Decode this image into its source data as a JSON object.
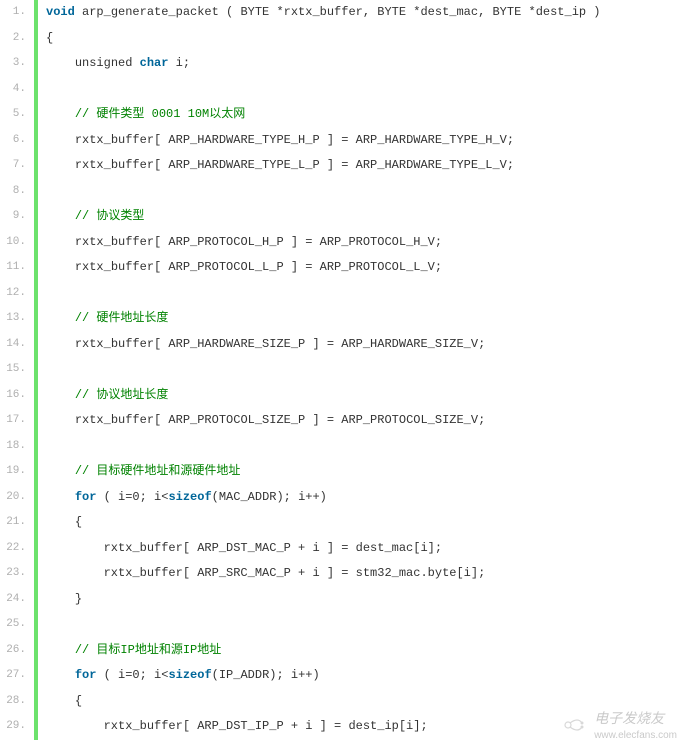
{
  "lines": [
    {
      "num": "1.",
      "indent": 0,
      "tokens": [
        {
          "t": "kw",
          "v": "void"
        },
        {
          "t": "",
          "v": " arp_generate_packet ( BYTE *rxtx_buffer, BYTE *dest_mac, BYTE *dest_ip )"
        }
      ]
    },
    {
      "num": "2.",
      "indent": 0,
      "tokens": [
        {
          "t": "",
          "v": "{"
        }
      ]
    },
    {
      "num": "3.",
      "indent": 1,
      "tokens": [
        {
          "t": "",
          "v": "unsigned "
        },
        {
          "t": "kw",
          "v": "char"
        },
        {
          "t": "",
          "v": " i;"
        }
      ]
    },
    {
      "num": "4.",
      "indent": 0,
      "tokens": []
    },
    {
      "num": "5.",
      "indent": 1,
      "tokens": [
        {
          "t": "comment",
          "v": "// 硬件类型 0001 10M以太网"
        }
      ]
    },
    {
      "num": "6.",
      "indent": 1,
      "tokens": [
        {
          "t": "",
          "v": "rxtx_buffer[ ARP_HARDWARE_TYPE_H_P ] = ARP_HARDWARE_TYPE_H_V;"
        }
      ]
    },
    {
      "num": "7.",
      "indent": 1,
      "tokens": [
        {
          "t": "",
          "v": "rxtx_buffer[ ARP_HARDWARE_TYPE_L_P ] = ARP_HARDWARE_TYPE_L_V;"
        }
      ]
    },
    {
      "num": "8.",
      "indent": 0,
      "tokens": []
    },
    {
      "num": "9.",
      "indent": 1,
      "tokens": [
        {
          "t": "comment",
          "v": "// 协议类型"
        }
      ]
    },
    {
      "num": "10.",
      "indent": 1,
      "tokens": [
        {
          "t": "",
          "v": "rxtx_buffer[ ARP_PROTOCOL_H_P ] = ARP_PROTOCOL_H_V;"
        }
      ]
    },
    {
      "num": "11.",
      "indent": 1,
      "tokens": [
        {
          "t": "",
          "v": "rxtx_buffer[ ARP_PROTOCOL_L_P ] = ARP_PROTOCOL_L_V;"
        }
      ]
    },
    {
      "num": "12.",
      "indent": 0,
      "tokens": []
    },
    {
      "num": "13.",
      "indent": 1,
      "tokens": [
        {
          "t": "comment",
          "v": "// 硬件地址长度"
        }
      ]
    },
    {
      "num": "14.",
      "indent": 1,
      "tokens": [
        {
          "t": "",
          "v": "rxtx_buffer[ ARP_HARDWARE_SIZE_P ] = ARP_HARDWARE_SIZE_V;"
        }
      ]
    },
    {
      "num": "15.",
      "indent": 0,
      "tokens": []
    },
    {
      "num": "16.",
      "indent": 1,
      "tokens": [
        {
          "t": "comment",
          "v": "// 协议地址长度"
        }
      ]
    },
    {
      "num": "17.",
      "indent": 1,
      "tokens": [
        {
          "t": "",
          "v": "rxtx_buffer[ ARP_PROTOCOL_SIZE_P ] = ARP_PROTOCOL_SIZE_V;"
        }
      ]
    },
    {
      "num": "18.",
      "indent": 0,
      "tokens": []
    },
    {
      "num": "19.",
      "indent": 1,
      "tokens": [
        {
          "t": "comment",
          "v": "// 目标硬件地址和源硬件地址"
        }
      ]
    },
    {
      "num": "20.",
      "indent": 1,
      "tokens": [
        {
          "t": "kw",
          "v": "for"
        },
        {
          "t": "",
          "v": " ( i=0; i<"
        },
        {
          "t": "kw",
          "v": "sizeof"
        },
        {
          "t": "",
          "v": "(MAC_ADDR); i++)"
        }
      ]
    },
    {
      "num": "21.",
      "indent": 1,
      "tokens": [
        {
          "t": "",
          "v": "{"
        }
      ]
    },
    {
      "num": "22.",
      "indent": 2,
      "tokens": [
        {
          "t": "",
          "v": "rxtx_buffer[ ARP_DST_MAC_P + i ] = dest_mac[i];"
        }
      ]
    },
    {
      "num": "23.",
      "indent": 2,
      "tokens": [
        {
          "t": "",
          "v": "rxtx_buffer[ ARP_SRC_MAC_P + i ] = stm32_mac.byte[i];"
        }
      ]
    },
    {
      "num": "24.",
      "indent": 1,
      "tokens": [
        {
          "t": "",
          "v": "}"
        }
      ]
    },
    {
      "num": "25.",
      "indent": 0,
      "tokens": []
    },
    {
      "num": "26.",
      "indent": 1,
      "tokens": [
        {
          "t": "comment",
          "v": "// 目标IP地址和源IP地址"
        }
      ]
    },
    {
      "num": "27.",
      "indent": 1,
      "tokens": [
        {
          "t": "kw",
          "v": "for"
        },
        {
          "t": "",
          "v": " ( i=0; i<"
        },
        {
          "t": "kw",
          "v": "sizeof"
        },
        {
          "t": "",
          "v": "(IP_ADDR); i++)"
        }
      ]
    },
    {
      "num": "28.",
      "indent": 1,
      "tokens": [
        {
          "t": "",
          "v": "{"
        }
      ]
    },
    {
      "num": "29.",
      "indent": 2,
      "tokens": [
        {
          "t": "",
          "v": "rxtx_buffer[ ARP_DST_IP_P + i ] = dest_ip[i];"
        }
      ]
    }
  ],
  "watermark": {
    "cn": "电子发烧友",
    "url": "www.elecfans.com"
  }
}
